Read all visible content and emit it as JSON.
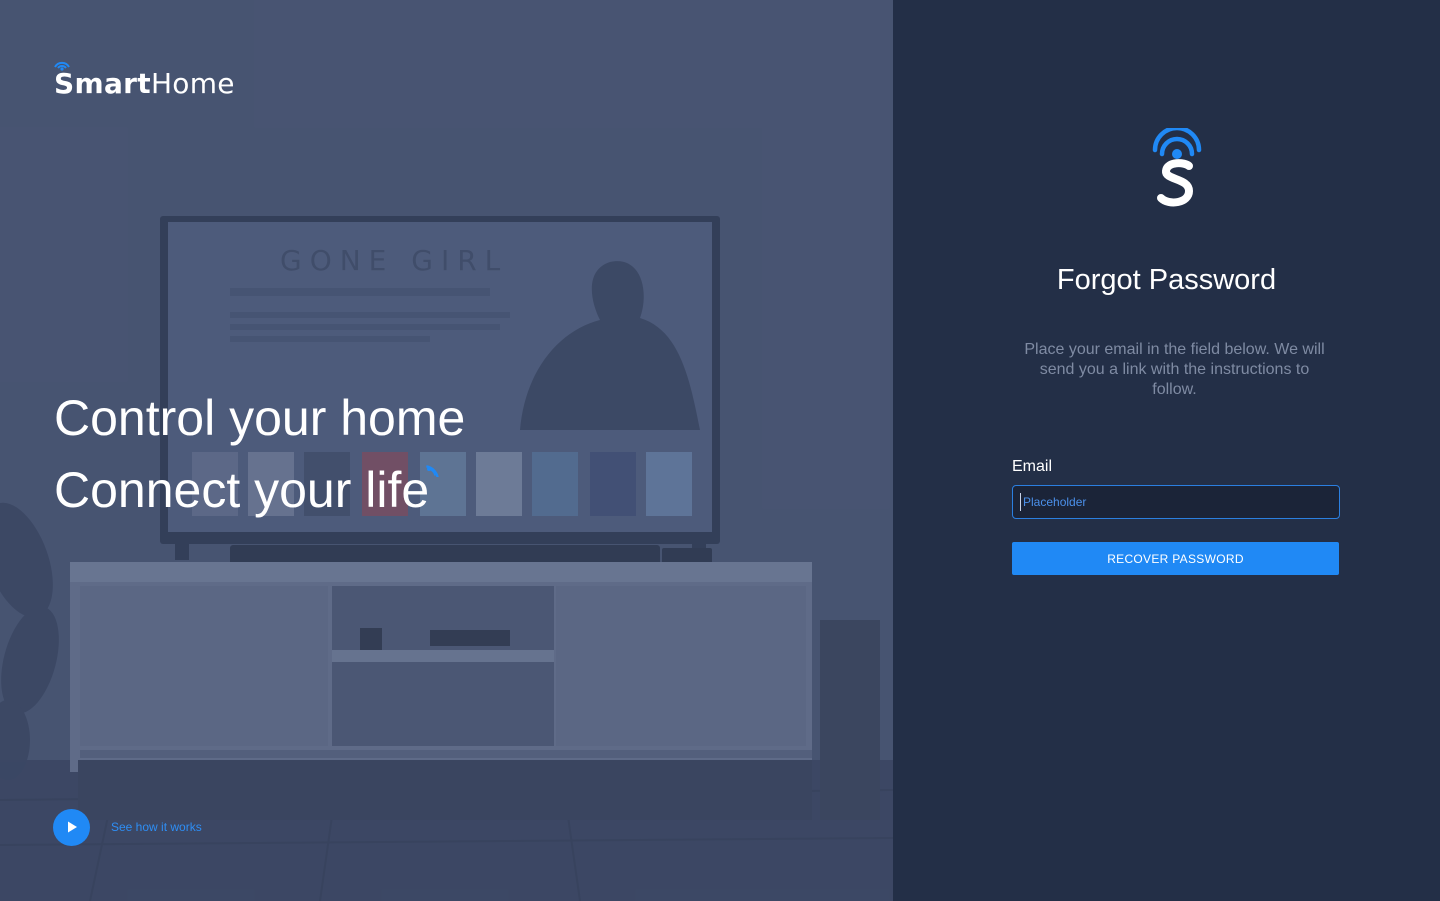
{
  "brand": {
    "name_bold": "Smart",
    "name_light": "Home",
    "logo_icon": "wifi-s-logo-icon"
  },
  "hero": {
    "headline_line1": "Control your home",
    "headline_line2": "Connect your life",
    "video_link_label": "See how it works",
    "play_icon": "play-icon",
    "tv_screen_title": "GONE GIRL"
  },
  "form": {
    "title": "Forgot Password",
    "description": "Place your email in the field below. We will send you a link with the instructions to follow.",
    "email_label": "Email",
    "email_placeholder": "Placeholder",
    "email_value": "",
    "submit_label": "RECOVER PASSWORD"
  },
  "colors": {
    "accent": "#2089f5",
    "panel_background": "#232f47",
    "hero_tint": "#4a5571",
    "muted_text": "#7f8ba3"
  }
}
